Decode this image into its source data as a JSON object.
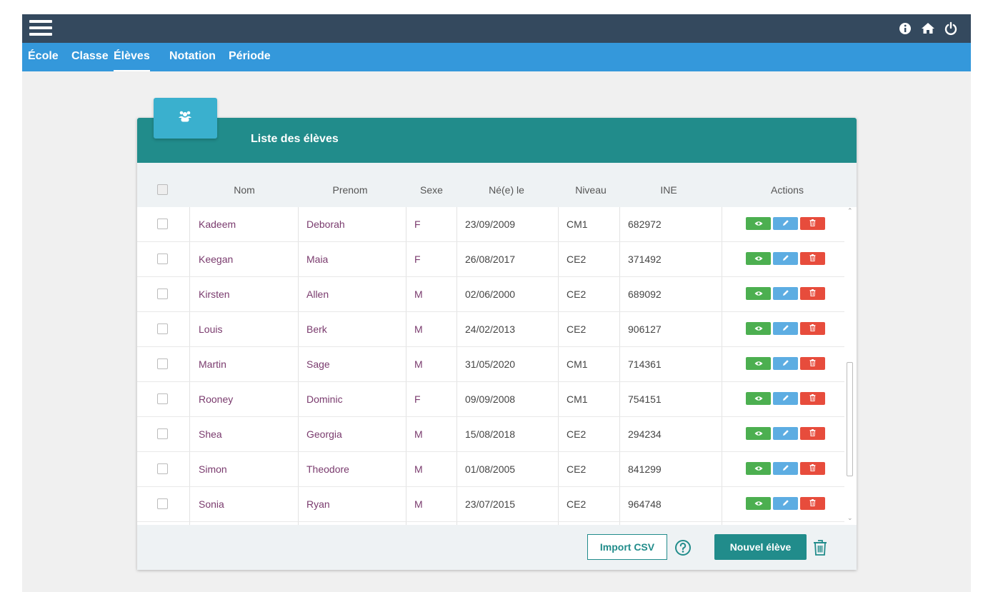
{
  "nav": {
    "items": [
      {
        "label": "École",
        "active": false
      },
      {
        "label": "Classe",
        "active": false
      },
      {
        "label": "Élèves",
        "active": true
      },
      {
        "label": "Notation",
        "active": false
      },
      {
        "label": "Période",
        "active": false
      }
    ]
  },
  "topbar": {
    "icons": [
      "info-icon",
      "home-icon",
      "power-icon"
    ]
  },
  "card": {
    "title": "Liste des élèves",
    "tab_icon": "users-icon"
  },
  "table": {
    "columns": [
      "Nom",
      "Prenom",
      "Sexe",
      "Né(e) le",
      "Niveau",
      "INE",
      "Actions"
    ],
    "rows": [
      {
        "nom": "Kadeem",
        "prenom": "Deborah",
        "sexe": "F",
        "ne_le": "23/09/2009",
        "niveau": "CM1",
        "ine": "682972"
      },
      {
        "nom": "Keegan",
        "prenom": "Maia",
        "sexe": "F",
        "ne_le": "26/08/2017",
        "niveau": "CE2",
        "ine": "371492"
      },
      {
        "nom": "Kirsten",
        "prenom": "Allen",
        "sexe": "M",
        "ne_le": "02/06/2000",
        "niveau": "CE2",
        "ine": "689092"
      },
      {
        "nom": "Louis",
        "prenom": "Berk",
        "sexe": "M",
        "ne_le": "24/02/2013",
        "niveau": "CE2",
        "ine": "906127"
      },
      {
        "nom": "Martin",
        "prenom": "Sage",
        "sexe": "M",
        "ne_le": "31/05/2020",
        "niveau": "CM1",
        "ine": "714361"
      },
      {
        "nom": "Rooney",
        "prenom": "Dominic",
        "sexe": "F",
        "ne_le": "09/09/2008",
        "niveau": "CM1",
        "ine": "754151"
      },
      {
        "nom": "Shea",
        "prenom": "Georgia",
        "sexe": "M",
        "ne_le": "15/08/2018",
        "niveau": "CE2",
        "ine": "294234"
      },
      {
        "nom": "Simon",
        "prenom": "Theodore",
        "sexe": "M",
        "ne_le": "01/08/2005",
        "niveau": "CE2",
        "ine": "841299"
      },
      {
        "nom": "Sonia",
        "prenom": "Ryan",
        "sexe": "M",
        "ne_le": "23/07/2015",
        "niveau": "CE2",
        "ine": "964748"
      }
    ]
  },
  "footer": {
    "import_label": "Import CSV",
    "new_label": "Nouvel élève"
  },
  "colors": {
    "topbar": "#34495e",
    "navbar": "#3498db",
    "header": "#218c8b",
    "view": "#4caf50",
    "edit": "#5dade2",
    "delete": "#e74c3c",
    "name_text": "#7a3b6e"
  }
}
